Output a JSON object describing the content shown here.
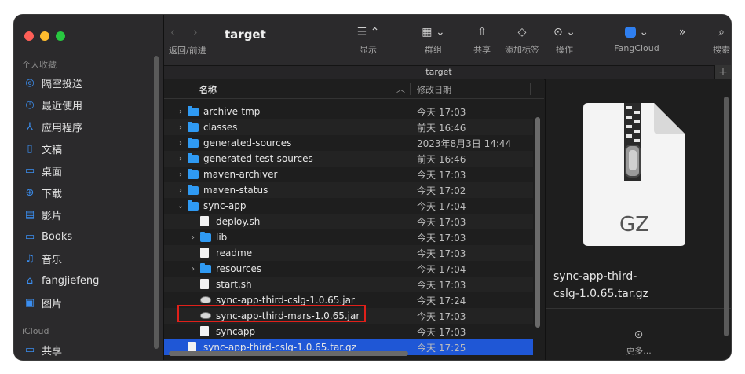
{
  "window": {
    "title": "target"
  },
  "colors": {
    "accent": "#2f9af3",
    "selection": "#1f57d6",
    "highlight_border": "#e0201a",
    "close": "#fe5f57",
    "minimize": "#febc2e",
    "zoom": "#28c840"
  },
  "sidebar": {
    "section_favorites": "个人收藏",
    "favorites": [
      {
        "label": "隔空投送",
        "icon": "airdrop-icon"
      },
      {
        "label": "最近使用",
        "icon": "clock-icon"
      },
      {
        "label": "应用程序",
        "icon": "applications-icon"
      },
      {
        "label": "文稿",
        "icon": "document-icon"
      },
      {
        "label": "桌面",
        "icon": "desktop-icon"
      },
      {
        "label": "下载",
        "icon": "download-icon"
      },
      {
        "label": "影片",
        "icon": "film-icon"
      },
      {
        "label": "Books",
        "icon": "folder-icon"
      },
      {
        "label": "音乐",
        "icon": "music-icon"
      },
      {
        "label": "fangjiefeng",
        "icon": "home-icon"
      },
      {
        "label": "图片",
        "icon": "photo-icon"
      }
    ],
    "section_icloud": "iCloud",
    "icloud": [
      {
        "label": "共享",
        "icon": "shared-folder-icon"
      }
    ]
  },
  "toolbar": {
    "nav_label": "返回/前进",
    "title": "target",
    "buttons": [
      {
        "label": "显示",
        "icon": "list-view-icon"
      },
      {
        "label": "群组",
        "icon": "group-icon"
      },
      {
        "label": "共享",
        "icon": "share-icon"
      },
      {
        "label": "添加标签",
        "icon": "tag-icon"
      },
      {
        "label": "操作",
        "icon": "more-icon"
      },
      {
        "label": "FangCloud",
        "icon": "fangcloud-icon"
      },
      {
        "label": "搜索",
        "icon": "search-icon"
      }
    ]
  },
  "pathbar": {
    "title": "target",
    "plus": "+"
  },
  "list": {
    "col_name": "名称",
    "col_date": "修改日期",
    "rows": [
      {
        "name": "archive-tmp",
        "date": "今天 17:03",
        "type": "folder",
        "indent": 0,
        "disclosure": "›"
      },
      {
        "name": "classes",
        "date": "前天 16:46",
        "type": "folder",
        "indent": 0,
        "disclosure": "›"
      },
      {
        "name": "generated-sources",
        "date": "2023年8月3日 14:44",
        "type": "folder",
        "indent": 0,
        "disclosure": "›"
      },
      {
        "name": "generated-test-sources",
        "date": "前天 16:46",
        "type": "folder",
        "indent": 0,
        "disclosure": "›"
      },
      {
        "name": "maven-archiver",
        "date": "今天 17:03",
        "type": "folder",
        "indent": 0,
        "disclosure": "›"
      },
      {
        "name": "maven-status",
        "date": "今天 17:02",
        "type": "folder",
        "indent": 0,
        "disclosure": "›"
      },
      {
        "name": "sync-app",
        "date": "今天 17:04",
        "type": "folder",
        "indent": 0,
        "disclosure": "⌄"
      },
      {
        "name": "deploy.sh",
        "date": "今天 17:03",
        "type": "doc",
        "indent": 1,
        "disclosure": ""
      },
      {
        "name": "lib",
        "date": "今天 17:03",
        "type": "folder",
        "indent": 1,
        "disclosure": "›"
      },
      {
        "name": "readme",
        "date": "今天 17:03",
        "type": "doc",
        "indent": 1,
        "disclosure": ""
      },
      {
        "name": "resources",
        "date": "今天 17:04",
        "type": "folder",
        "indent": 1,
        "disclosure": "›"
      },
      {
        "name": "start.sh",
        "date": "今天 17:03",
        "type": "doc",
        "indent": 1,
        "disclosure": ""
      },
      {
        "name": "sync-app-third-cslg-1.0.65.jar",
        "date": "今天 17:24",
        "type": "jar",
        "indent": 1,
        "disclosure": ""
      },
      {
        "name": "sync-app-third-mars-1.0.65.jar",
        "date": "今天 17:03",
        "type": "jar",
        "indent": 1,
        "disclosure": ""
      },
      {
        "name": "syncapp",
        "date": "今天 17:03",
        "type": "doc",
        "indent": 1,
        "disclosure": ""
      },
      {
        "name": "sync-app-third-cslg-1.0.65.tar.gz",
        "date": "今天 17:25",
        "type": "doc",
        "indent": 0,
        "disclosure": "",
        "selected": true
      }
    ]
  },
  "preview": {
    "badge": "GZ",
    "filename": "sync-app-third-cslg-1.0.65.tar.gz",
    "more_label": "更多...",
    "more_icon": "ellipsis-circle-icon"
  }
}
